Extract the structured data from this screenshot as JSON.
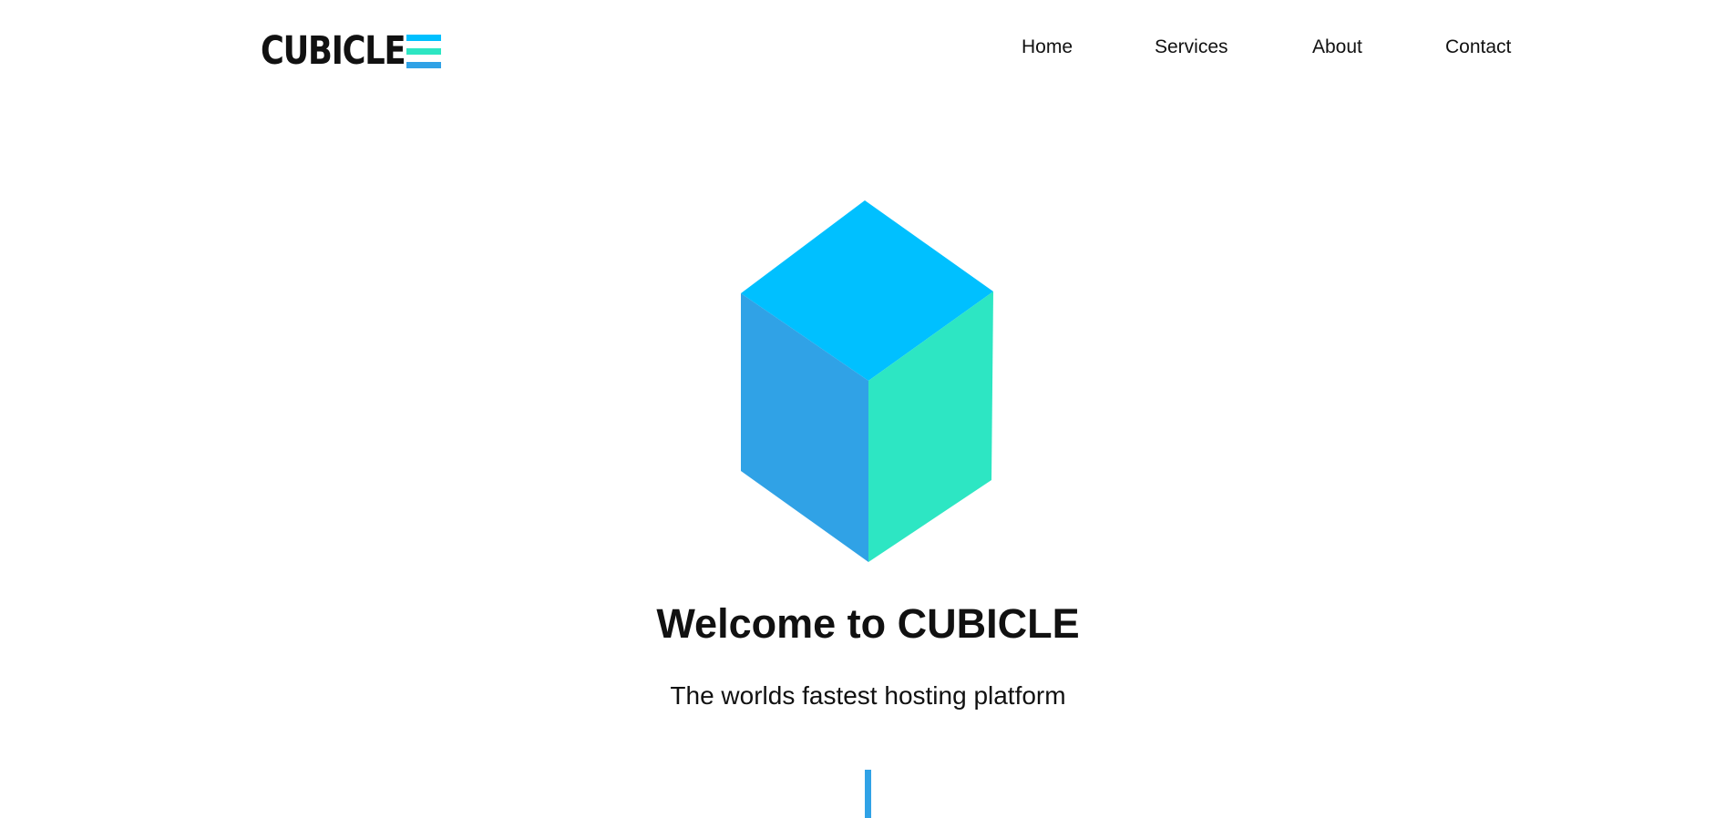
{
  "brand": {
    "name": "CUBICLE",
    "bar_colors": [
      "#00c0ff",
      "#2de6c3",
      "#30a2e6"
    ],
    "icon": "menu-bars-icon"
  },
  "nav": {
    "items": [
      {
        "label": "Home"
      },
      {
        "label": "Services"
      },
      {
        "label": "About"
      },
      {
        "label": "Contact"
      }
    ]
  },
  "hero": {
    "title": "Welcome to CUBICLE",
    "subtitle": "The worlds fastest hosting platform",
    "cube_colors": {
      "top": "#00c0ff",
      "left": "#30a2e6",
      "right": "#2de6c3"
    },
    "scroll_indicator_color": "#30a2e6"
  }
}
